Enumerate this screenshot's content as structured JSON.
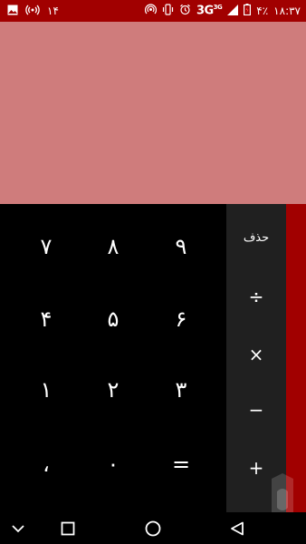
{
  "status_bar": {
    "left_number": "۱۴",
    "battery_percent": "۴٪",
    "time": "۱۸:۳۷",
    "network": "3G",
    "network_sup": "3G",
    "icons": [
      "image-icon",
      "broadcast-icon",
      "hotspot-icon",
      "vibrate-icon",
      "alarm-icon",
      "signal-icon",
      "battery-icon"
    ]
  },
  "display": {
    "value": ""
  },
  "keypad": {
    "keys": [
      "۷",
      "۸",
      "۹",
      "۴",
      "۵",
      "۶",
      "۱",
      "۲",
      "۳",
      "،",
      "۰",
      "="
    ]
  },
  "operators": {
    "delete": "حذف",
    "divide": "÷",
    "multiply": "×",
    "minus": "−",
    "plus": "+"
  },
  "navbar": {
    "icons": [
      "chevron-down-icon",
      "recents-square-icon",
      "home-circle-icon",
      "back-triangle-icon"
    ]
  },
  "colors": {
    "status_bar": "#a10000",
    "display": "#cf7c7c",
    "keypad": "#000000",
    "operators": "#202020",
    "accent": "#a10000"
  }
}
